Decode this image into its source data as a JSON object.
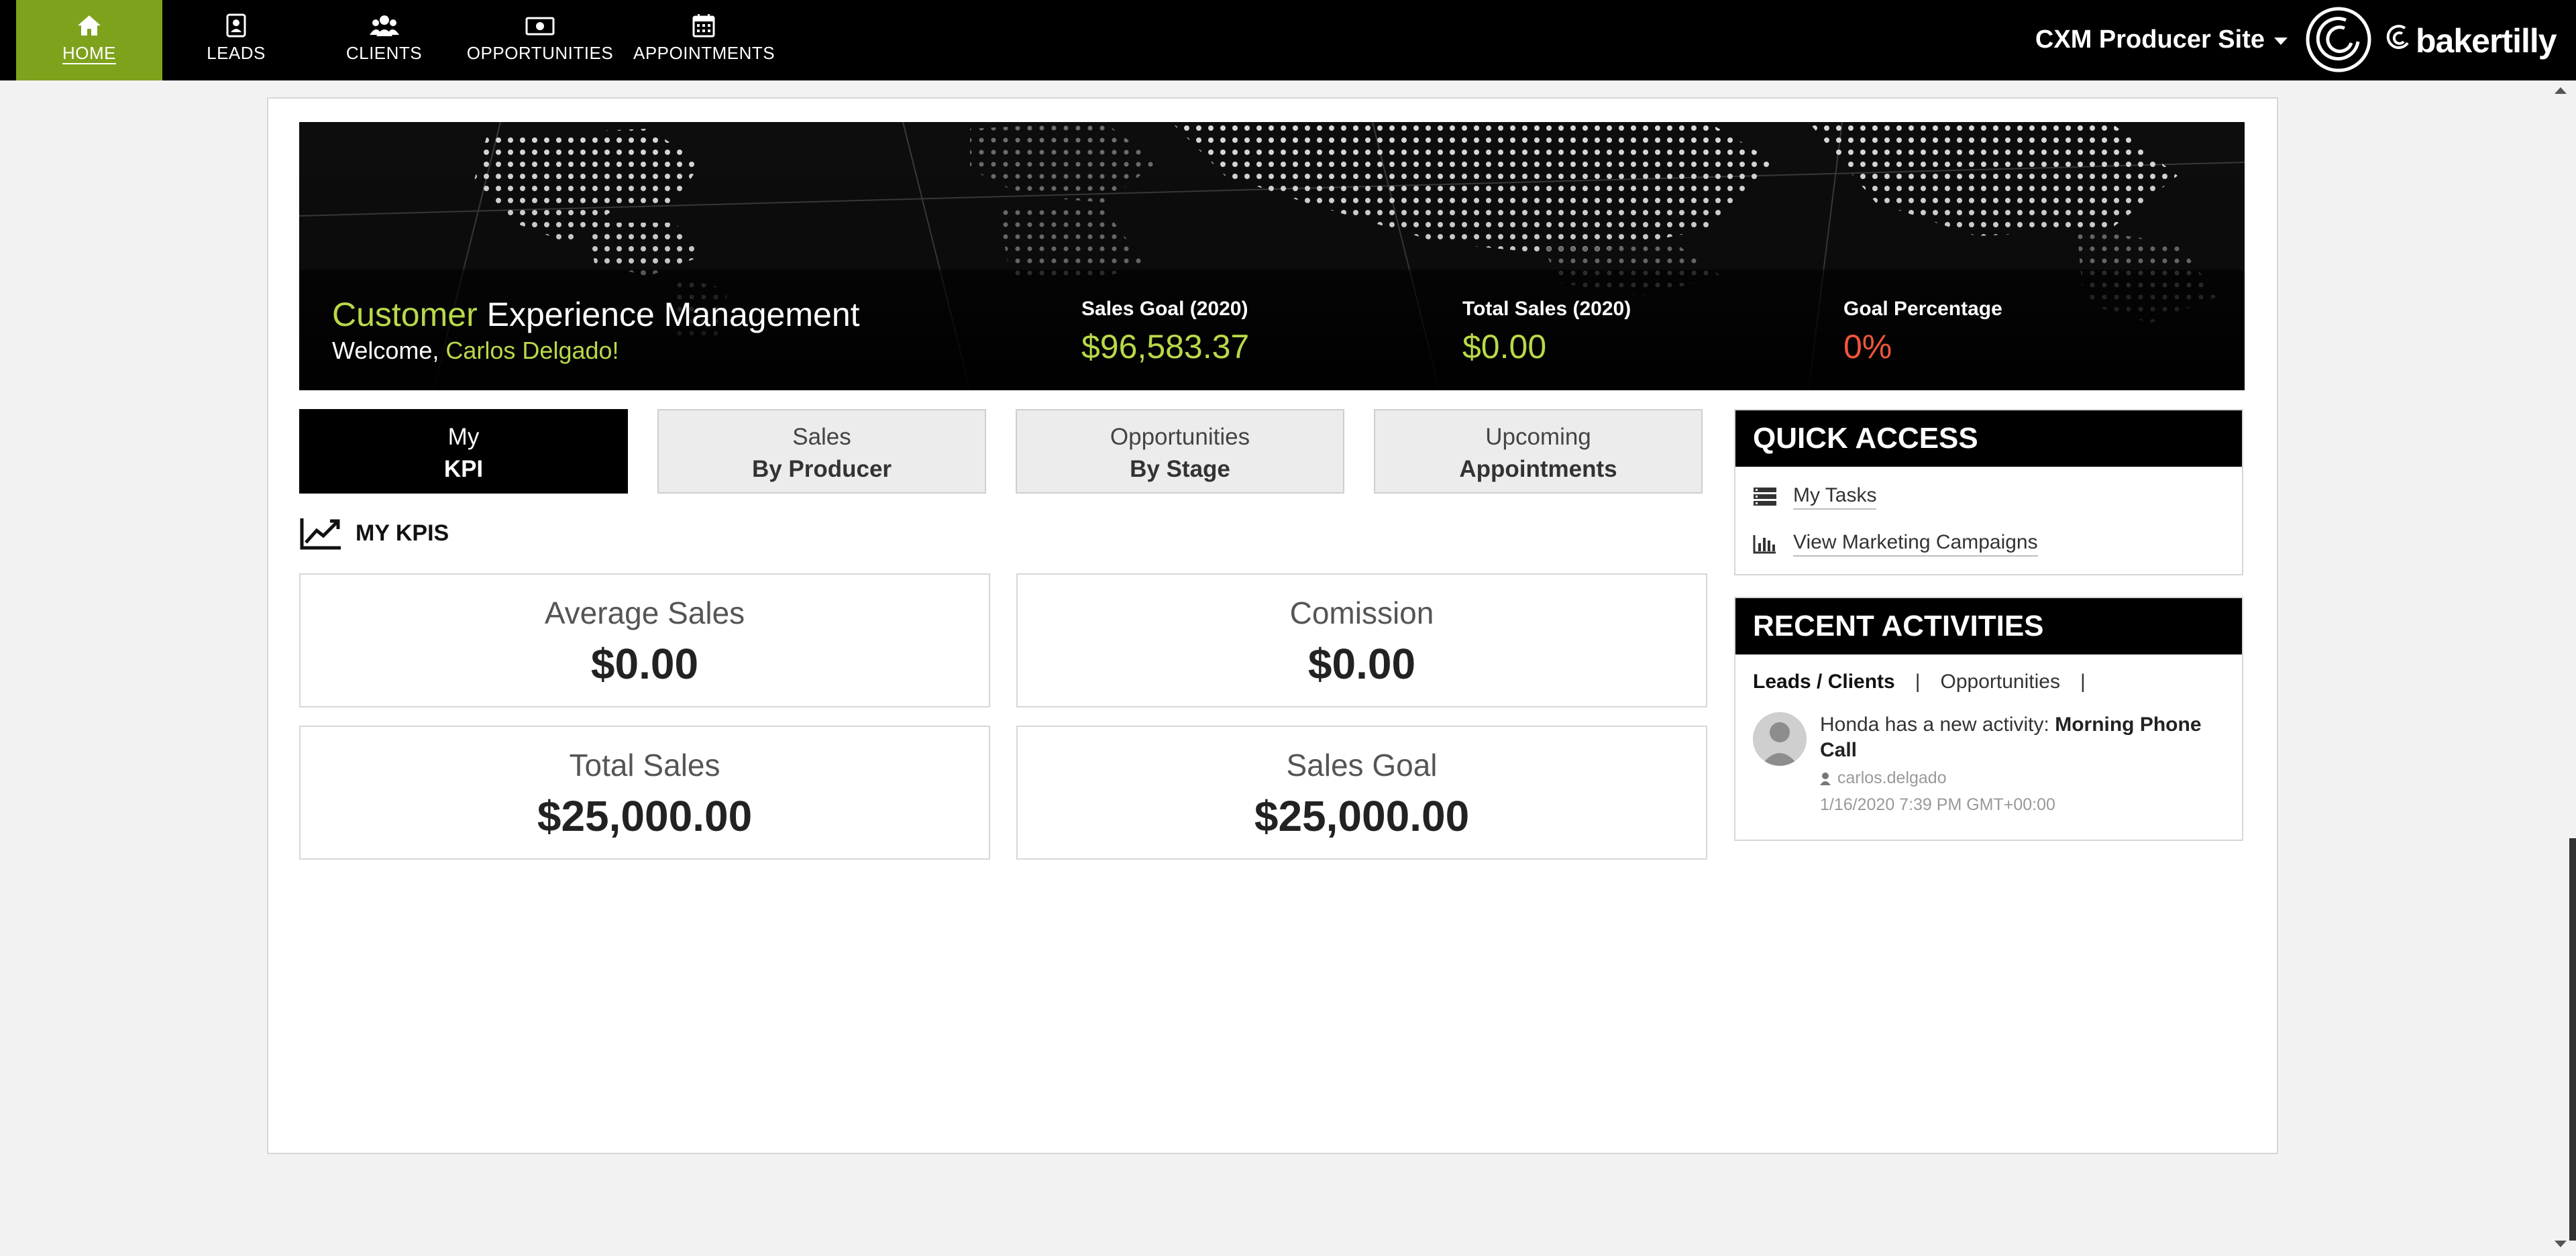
{
  "nav": {
    "items": [
      {
        "label": "HOME",
        "icon": "home-icon"
      },
      {
        "label": "LEADS",
        "icon": "contact-card-icon"
      },
      {
        "label": "CLIENTS",
        "icon": "users-icon"
      },
      {
        "label": "OPPORTUNITIES",
        "icon": "money-icon"
      },
      {
        "label": "APPOINTMENTS",
        "icon": "calendar-icon"
      }
    ],
    "active_item": "HOME",
    "site_selector": "CXM Producer Site",
    "brand": "bakertilly",
    "active_color": "#7fa21c"
  },
  "banner": {
    "title_accent": "Customer",
    "title_rest": "Experience Management",
    "welcome_prefix": "Welcome,",
    "welcome_name": "Carlos Delgado!",
    "stats": [
      {
        "label": "Sales Goal (2020)",
        "value": "$96,583.37",
        "color": "#b8d94a"
      },
      {
        "label": "Total Sales (2020)",
        "value": "$0.00",
        "color": "#b8d94a"
      },
      {
        "label": "Goal Percentage",
        "value": "0%",
        "color": "#f0553a"
      }
    ]
  },
  "tabs": [
    {
      "line1": "My",
      "line2": "KPI",
      "active": true
    },
    {
      "line1": "Sales",
      "line2": "By Producer",
      "active": false
    },
    {
      "line1": "Opportunities",
      "line2": "By Stage",
      "active": false
    },
    {
      "line1": "Upcoming",
      "line2": "Appointments",
      "active": false
    }
  ],
  "kpi": {
    "title": "MY KPIS",
    "cards": [
      {
        "label": "Average Sales",
        "value": "$0.00"
      },
      {
        "label": "Comission",
        "value": "$0.00"
      },
      {
        "label": "Total Sales",
        "value": "$25,000.00"
      },
      {
        "label": "Sales Goal",
        "value": "$25,000.00"
      }
    ]
  },
  "quick_access": {
    "title": "QUICK ACCESS",
    "links": [
      {
        "label": "My Tasks",
        "icon": "task-list-icon"
      },
      {
        "label": "View Marketing Campaigns",
        "icon": "bar-chart-icon"
      }
    ]
  },
  "recent_activities": {
    "title": "RECENT ACTIVITIES",
    "tabs": [
      "Leads / Clients",
      "|",
      "Opportunities",
      "|"
    ],
    "items": [
      {
        "text_prefix": "Honda has a new activity:",
        "activity": "Morning Phone Call",
        "user": "carlos.delgado",
        "time": "1/16/2020 7:39 PM GMT+00:00"
      }
    ]
  }
}
